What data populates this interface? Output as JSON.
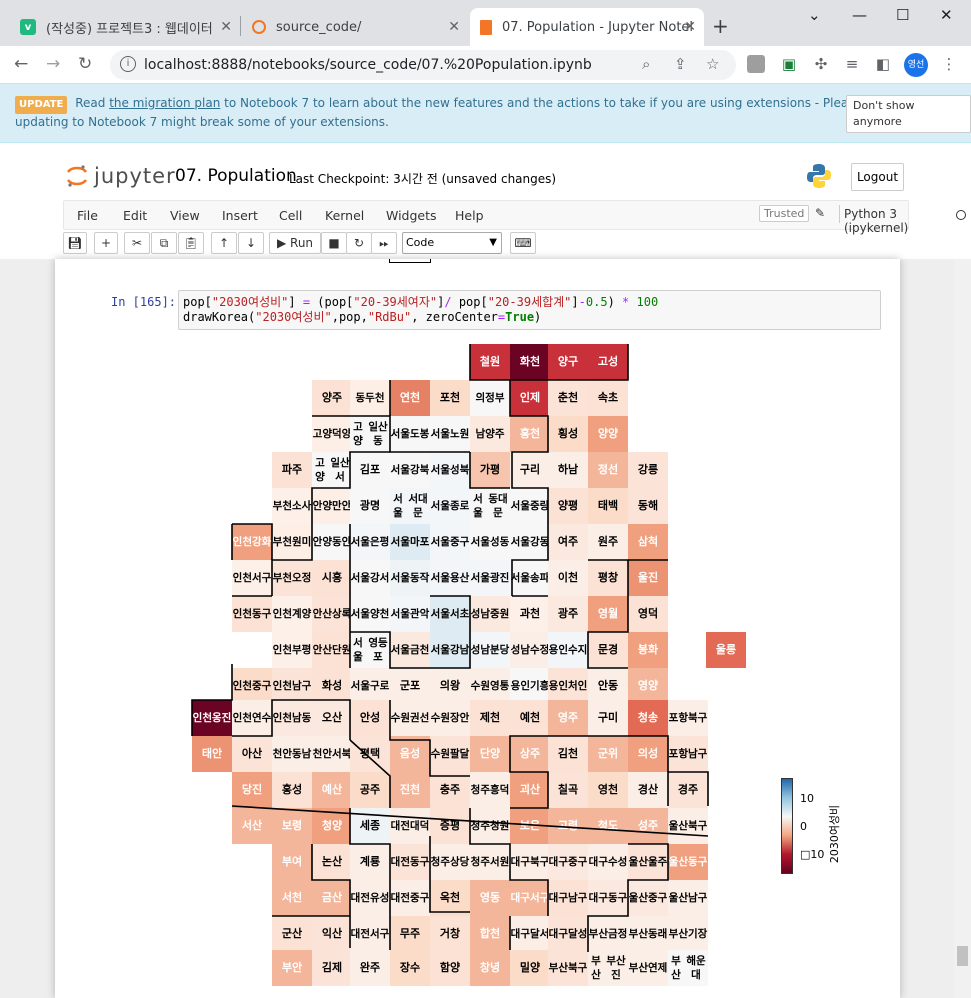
{
  "browser": {
    "tabs": [
      {
        "title": "(작성중) 프로젝트3 : 웹데이터",
        "icon": "v-icon",
        "color": "#20b980"
      },
      {
        "title": "source_code/",
        "icon": "jupyter-tab-icon",
        "color": "#f37626"
      },
      {
        "title": "07. Population - Jupyter Notel",
        "icon": "jupyter-tab-icon",
        "color": "#f37626"
      }
    ],
    "url": "localhost:8888/notebooks/source_code/07.%20Population.ipynb",
    "profile": "영선"
  },
  "banner": {
    "badge": "UPDATE",
    "text_before": "Read",
    "link": "the migration plan",
    "text_after": "to Notebook 7 to learn about the new features and the actions to take if you are using extensions - Please note that updating to Notebook 7 might break some of your extensions.",
    "dismiss": "Don't show anymore"
  },
  "jupyter": {
    "logo": "jupyter",
    "notebook_name": "07. Population",
    "checkpoint": "Last Checkpoint: 3시간 전  (unsaved changes)",
    "logout": "Logout",
    "menu": [
      "File",
      "Edit",
      "View",
      "Insert",
      "Cell",
      "Kernel",
      "Widgets",
      "Help"
    ],
    "trusted": "Trusted",
    "kernel": "Python 3 (ipykernel)",
    "run_label": "Run",
    "cell_type": "Code"
  },
  "cell": {
    "prompt": "In [165]:"
  },
  "chart_data": {
    "type": "heatmap",
    "colormap": "RdBu",
    "colorbar_label": "2030여성비",
    "colorbar_ticks": [
      "10",
      "0",
      "□10"
    ],
    "cells": [
      {
        "label": "철원",
        "color": "#c8303a",
        "text": "#fff"
      },
      {
        "label": "화천",
        "color": "#6b0322",
        "text": "#fff"
      },
      {
        "label": "양구",
        "color": "#c8303a",
        "text": "#fff"
      },
      {
        "label": "고성",
        "color": "#c8303a",
        "text": "#fff"
      },
      {
        "label": "양주",
        "color": "#fbe2d4",
        "text": "#000"
      },
      {
        "label": "동두천",
        "color": "#fdeee6",
        "text": "#000"
      },
      {
        "label": "연천",
        "color": "#e58266",
        "text": "#fff"
      },
      {
        "label": "포천",
        "color": "#fbdcc9",
        "text": "#000"
      },
      {
        "label": "의정부",
        "color": "#f7f7f7",
        "text": "#000"
      },
      {
        "label": "인제",
        "color": "#c8303a",
        "text": "#fff"
      },
      {
        "label": "춘천",
        "color": "#fbe4d7",
        "text": "#000"
      },
      {
        "label": "속초",
        "color": "#fbe2d4",
        "text": "#000"
      },
      {
        "label": "고양\n덕양",
        "color": "#fdeee6",
        "text": "#000"
      },
      {
        "label": "고양\n일산동",
        "color": "#f7f7f7",
        "text": "#000"
      },
      {
        "label": "서울\n도봉",
        "color": "#f7f7f7",
        "text": "#000"
      },
      {
        "label": "서울\n노원",
        "color": "#f7f7f7",
        "text": "#000"
      },
      {
        "label": "남양주",
        "color": "#fbe8de",
        "text": "#000"
      },
      {
        "label": "홍천",
        "color": "#f4b69b",
        "text": "#fff"
      },
      {
        "label": "횡성",
        "color": "#fbdcc9",
        "text": "#000"
      },
      {
        "label": "양양",
        "color": "#f0a07f",
        "text": "#fff"
      },
      {
        "label": "파주",
        "color": "#fbe2d4",
        "text": "#000"
      },
      {
        "label": "고양\n일산서",
        "color": "#f7f7f7",
        "text": "#000"
      },
      {
        "label": "김포",
        "color": "#f7f7f7",
        "text": "#000"
      },
      {
        "label": "서울\n강북",
        "color": "#f7f7f7",
        "text": "#000"
      },
      {
        "label": "서울\n성북",
        "color": "#f3f6f8",
        "text": "#000"
      },
      {
        "label": "가평",
        "color": "#f7c5ad",
        "text": "#000"
      },
      {
        "label": "구리",
        "color": "#fbeee6",
        "text": "#000"
      },
      {
        "label": "하남",
        "color": "#fbeee6",
        "text": "#000"
      },
      {
        "label": "정선",
        "color": "#f4b69b",
        "text": "#fff"
      },
      {
        "label": "강릉",
        "color": "#fbe4d7",
        "text": "#000"
      },
      {
        "label": "부천\n소사",
        "color": "#fdf0e9",
        "text": "#000"
      },
      {
        "label": "안양\n만안",
        "color": "#fdeee6",
        "text": "#000"
      },
      {
        "label": "광명",
        "color": "#f7f7f7",
        "text": "#000"
      },
      {
        "label": "서울\n서대문",
        "color": "#f3f6f8",
        "text": "#000"
      },
      {
        "label": "서울\n종로",
        "color": "#f3f6f8",
        "text": "#000"
      },
      {
        "label": "서울\n동대문",
        "color": "#f7f7f7",
        "text": "#000"
      },
      {
        "label": "서울\n중랑",
        "color": "#f7f7f7",
        "text": "#000"
      },
      {
        "label": "양평",
        "color": "#fbe2d4",
        "text": "#000"
      },
      {
        "label": "태백",
        "color": "#fbdcc9",
        "text": "#000"
      },
      {
        "label": "동해",
        "color": "#fbe4d7",
        "text": "#000"
      },
      {
        "label": "인천\n강화",
        "color": "#f0a07f",
        "text": "#fff"
      },
      {
        "label": "부천\n원미",
        "color": "#fdeee6",
        "text": "#000"
      },
      {
        "label": "안양\n동안",
        "color": "#f7f7f7",
        "text": "#000"
      },
      {
        "label": "서울\n은평",
        "color": "#f3f6f8",
        "text": "#000"
      },
      {
        "label": "서울\n마포",
        "color": "#deebf2",
        "text": "#000"
      },
      {
        "label": "서울\n중구",
        "color": "#f3f6f8",
        "text": "#000"
      },
      {
        "label": "서울\n성동",
        "color": "#f7f7f7",
        "text": "#000"
      },
      {
        "label": "서울\n강동",
        "color": "#f7f7f7",
        "text": "#000"
      },
      {
        "label": "여주",
        "color": "#fbe8de",
        "text": "#000"
      },
      {
        "label": "원주",
        "color": "#fbeee6",
        "text": "#000"
      },
      {
        "label": "삼척",
        "color": "#f0a07f",
        "text": "#fff"
      },
      {
        "label": "인천\n서구",
        "color": "#fdf0e9",
        "text": "#000"
      },
      {
        "label": "부천\n오정",
        "color": "#fbe4d7",
        "text": "#000"
      },
      {
        "label": "시흥",
        "color": "#fbe2d4",
        "text": "#000"
      },
      {
        "label": "서울\n강서",
        "color": "#f7f7f7",
        "text": "#000"
      },
      {
        "label": "서울\n동작",
        "color": "#eef3f6",
        "text": "#000"
      },
      {
        "label": "서울\n용산",
        "color": "#f3f6f8",
        "text": "#000"
      },
      {
        "label": "서울\n광진",
        "color": "#f3f6f8",
        "text": "#000"
      },
      {
        "label": "서울\n송파",
        "color": "#f7f7f7",
        "text": "#000"
      },
      {
        "label": "이천",
        "color": "#fbeee6",
        "text": "#000"
      },
      {
        "label": "평창",
        "color": "#fbe2d4",
        "text": "#000"
      },
      {
        "label": "울진",
        "color": "#ec9373",
        "text": "#fff"
      },
      {
        "label": "인천\n동구",
        "color": "#fbe2d4",
        "text": "#000"
      },
      {
        "label": "인천\n계양",
        "color": "#fdf0e9",
        "text": "#000"
      },
      {
        "label": "안산\n상록",
        "color": "#fbe4d7",
        "text": "#000"
      },
      {
        "label": "서울\n양천",
        "color": "#f7f7f7",
        "text": "#000"
      },
      {
        "label": "서울\n관악",
        "color": "#f3f6f8",
        "text": "#000"
      },
      {
        "label": "서울\n서초",
        "color": "#deebf2",
        "text": "#000"
      },
      {
        "label": "성남\n중원",
        "color": "#fbe8de",
        "text": "#000"
      },
      {
        "label": "과천",
        "color": "#fdf0e9",
        "text": "#000"
      },
      {
        "label": "광주",
        "color": "#fbe8de",
        "text": "#000"
      },
      {
        "label": "영월",
        "color": "#f0a07f",
        "text": "#fff"
      },
      {
        "label": "영덕",
        "color": "#fbe2d4",
        "text": "#000"
      },
      {
        "label": "인천\n부평",
        "color": "#fdf0e9",
        "text": "#000"
      },
      {
        "label": "안산\n단원",
        "color": "#fbe2d4",
        "text": "#000"
      },
      {
        "label": "서울\n영등포",
        "color": "#f7f7f7",
        "text": "#000"
      },
      {
        "label": "서울\n금천",
        "color": "#fbe8de",
        "text": "#000"
      },
      {
        "label": "서울\n강남",
        "color": "#deebf2",
        "text": "#000"
      },
      {
        "label": "성남\n분당",
        "color": "#f3f6f8",
        "text": "#000"
      },
      {
        "label": "성남\n수정",
        "color": "#fbeee6",
        "text": "#000"
      },
      {
        "label": "용인\n수지",
        "color": "#f3f6f8",
        "text": "#000"
      },
      {
        "label": "문경",
        "color": "#fbe2d4",
        "text": "#000"
      },
      {
        "label": "봉화",
        "color": "#f0a07f",
        "text": "#fff"
      },
      {
        "label": "울릉",
        "color": "#e36b55",
        "text": "#fff"
      },
      {
        "label": "인천\n중구",
        "color": "#fbdcc9",
        "text": "#000"
      },
      {
        "label": "인천\n남구",
        "color": "#fbe4d7",
        "text": "#000"
      },
      {
        "label": "화성",
        "color": "#fbe2d4",
        "text": "#000"
      },
      {
        "label": "서울\n구로",
        "color": "#fbeee6",
        "text": "#000"
      },
      {
        "label": "군포",
        "color": "#fbeee6",
        "text": "#000"
      },
      {
        "label": "의왕",
        "color": "#fbeee6",
        "text": "#000"
      },
      {
        "label": "수원\n영통",
        "color": "#fbeee6",
        "text": "#000"
      },
      {
        "label": "용인\n기흥",
        "color": "#f7f7f7",
        "text": "#000"
      },
      {
        "label": "용인\n처인",
        "color": "#fbe4d7",
        "text": "#000"
      },
      {
        "label": "안동",
        "color": "#fbeee6",
        "text": "#000"
      },
      {
        "label": "영양",
        "color": "#f4b69b",
        "text": "#fff"
      },
      {
        "label": "인천\n옹진",
        "color": "#6b0322",
        "text": "#fff"
      },
      {
        "label": "인천\n연수",
        "color": "#fbeee6",
        "text": "#000"
      },
      {
        "label": "인천\n남동",
        "color": "#fbe8de",
        "text": "#000"
      },
      {
        "label": "오산",
        "color": "#fbe8de",
        "text": "#000"
      },
      {
        "label": "안성",
        "color": "#fbe2d4",
        "text": "#000"
      },
      {
        "label": "수원\n권선",
        "color": "#fbeee6",
        "text": "#000"
      },
      {
        "label": "수원\n장안",
        "color": "#fbeee6",
        "text": "#000"
      },
      {
        "label": "제천",
        "color": "#fbe2d4",
        "text": "#000"
      },
      {
        "label": "예천",
        "color": "#fbe2d4",
        "text": "#000"
      },
      {
        "label": "영주",
        "color": "#f4b69b",
        "text": "#fff"
      },
      {
        "label": "구미",
        "color": "#fbeee6",
        "text": "#000"
      },
      {
        "label": "청송",
        "color": "#e36b55",
        "text": "#fff"
      },
      {
        "label": "포항\n북구",
        "color": "#fbeee6",
        "text": "#000"
      },
      {
        "label": "태안",
        "color": "#ec9373",
        "text": "#fff"
      },
      {
        "label": "아산",
        "color": "#fbe4d7",
        "text": "#000"
      },
      {
        "label": "천안\n동남",
        "color": "#fbeee6",
        "text": "#000"
      },
      {
        "label": "천안\n서북",
        "color": "#fbeee6",
        "text": "#000"
      },
      {
        "label": "평택",
        "color": "#fbe4d7",
        "text": "#000"
      },
      {
        "label": "음성",
        "color": "#f4b69b",
        "text": "#fff"
      },
      {
        "label": "수원\n팔달",
        "color": "#fbe4d7",
        "text": "#000"
      },
      {
        "label": "단양",
        "color": "#f4b69b",
        "text": "#fff"
      },
      {
        "label": "상주",
        "color": "#f4b69b",
        "text": "#fff"
      },
      {
        "label": "김천",
        "color": "#fbe2d4",
        "text": "#000"
      },
      {
        "label": "군위",
        "color": "#f4b69b",
        "text": "#fff"
      },
      {
        "label": "의성",
        "color": "#f0a07f",
        "text": "#fff"
      },
      {
        "label": "포항\n남구",
        "color": "#fbe4d7",
        "text": "#000"
      },
      {
        "label": "당진",
        "color": "#f0a07f",
        "text": "#fff"
      },
      {
        "label": "홍성",
        "color": "#fbe2d4",
        "text": "#000"
      },
      {
        "label": "예산",
        "color": "#f4b69b",
        "text": "#fff"
      },
      {
        "label": "공주",
        "color": "#fbdcc9",
        "text": "#000"
      },
      {
        "label": "진천",
        "color": "#f4b69b",
        "text": "#fff"
      },
      {
        "label": "충주",
        "color": "#fbe2d4",
        "text": "#000"
      },
      {
        "label": "청주\n흥덕",
        "color": "#fbeee6",
        "text": "#000"
      },
      {
        "label": "괴산",
        "color": "#f0a07f",
        "text": "#fff"
      },
      {
        "label": "칠곡",
        "color": "#fbe4d7",
        "text": "#000"
      },
      {
        "label": "영천",
        "color": "#fbdcc9",
        "text": "#000"
      },
      {
        "label": "경산",
        "color": "#fbeee6",
        "text": "#000"
      },
      {
        "label": "경주",
        "color": "#fbe4d7",
        "text": "#000"
      },
      {
        "label": "서산",
        "color": "#f4b69b",
        "text": "#fff"
      },
      {
        "label": "보령",
        "color": "#f4b69b",
        "text": "#fff"
      },
      {
        "label": "청양",
        "color": "#f0a07f",
        "text": "#fff"
      },
      {
        "label": "세종",
        "color": "#eef3f6",
        "text": "#000"
      },
      {
        "label": "대전\n대덕",
        "color": "#fbeee6",
        "text": "#000"
      },
      {
        "label": "증평",
        "color": "#fbe2d4",
        "text": "#000"
      },
      {
        "label": "청주\n청원",
        "color": "#fbeee6",
        "text": "#000"
      },
      {
        "label": "보은",
        "color": "#f0a07f",
        "text": "#fff"
      },
      {
        "label": "고령",
        "color": "#f4b69b",
        "text": "#fff"
      },
      {
        "label": "청도",
        "color": "#f4b69b",
        "text": "#fff"
      },
      {
        "label": "성주",
        "color": "#f4b69b",
        "text": "#fff"
      },
      {
        "label": "울산\n북구",
        "color": "#fbeee6",
        "text": "#000"
      },
      {
        "label": "부여",
        "color": "#f4b69b",
        "text": "#fff"
      },
      {
        "label": "논산",
        "color": "#fbe2d4",
        "text": "#000"
      },
      {
        "label": "계룡",
        "color": "#fbeee6",
        "text": "#000"
      },
      {
        "label": "대전\n동구",
        "color": "#fbe4d7",
        "text": "#000"
      },
      {
        "label": "청주\n상당",
        "color": "#fbeee6",
        "text": "#000"
      },
      {
        "label": "청주\n서원",
        "color": "#fbeee6",
        "text": "#000"
      },
      {
        "label": "대구\n북구",
        "color": "#fbeee6",
        "text": "#000"
      },
      {
        "label": "대구\n중구",
        "color": "#fbe8de",
        "text": "#000"
      },
      {
        "label": "대구\n수성",
        "color": "#fbeee6",
        "text": "#000"
      },
      {
        "label": "울산\n울주",
        "color": "#fbe4d7",
        "text": "#000"
      },
      {
        "label": "울산\n동구",
        "color": "#f0a07f",
        "text": "#fff"
      },
      {
        "label": "서천",
        "color": "#f4b69b",
        "text": "#fff"
      },
      {
        "label": "금산",
        "color": "#f4b69b",
        "text": "#fff"
      },
      {
        "label": "대전\n유성",
        "color": "#fbeee6",
        "text": "#000"
      },
      {
        "label": "대전\n중구",
        "color": "#fbeee6",
        "text": "#000"
      },
      {
        "label": "옥천",
        "color": "#fbdcc9",
        "text": "#000"
      },
      {
        "label": "영동",
        "color": "#f4b69b",
        "text": "#fff"
      },
      {
        "label": "대구\n서구",
        "color": "#f4b69b",
        "text": "#fff"
      },
      {
        "label": "대구\n남구",
        "color": "#fbe2d4",
        "text": "#000"
      },
      {
        "label": "대구\n동구",
        "color": "#fbe8de",
        "text": "#000"
      },
      {
        "label": "울산\n중구",
        "color": "#fbe8de",
        "text": "#000"
      },
      {
        "label": "울산\n남구",
        "color": "#fbeee6",
        "text": "#000"
      },
      {
        "label": "군산",
        "color": "#fbe2d4",
        "text": "#000"
      },
      {
        "label": "익산",
        "color": "#fbe4d7",
        "text": "#000"
      },
      {
        "label": "대전\n서구",
        "color": "#fbeee6",
        "text": "#000"
      },
      {
        "label": "무주",
        "color": "#fbdcc9",
        "text": "#000"
      },
      {
        "label": "거창",
        "color": "#fbe2d4",
        "text": "#000"
      },
      {
        "label": "합천",
        "color": "#f4b69b",
        "text": "#fff"
      },
      {
        "label": "대구\n달서",
        "color": "#fbeee6",
        "text": "#000"
      },
      {
        "label": "대구\n달성",
        "color": "#fbe4d7",
        "text": "#000"
      },
      {
        "label": "부산\n금정",
        "color": "#fbeee6",
        "text": "#000"
      },
      {
        "label": "부산\n동래",
        "color": "#fbeee6",
        "text": "#000"
      },
      {
        "label": "부산\n기장",
        "color": "#fbeee6",
        "text": "#000"
      },
      {
        "label": "부안",
        "color": "#f4b69b",
        "text": "#fff"
      },
      {
        "label": "김제",
        "color": "#fbe4d7",
        "text": "#000"
      },
      {
        "label": "완주",
        "color": "#fbeee6",
        "text": "#000"
      },
      {
        "label": "장수",
        "color": "#fbdcc9",
        "text": "#000"
      },
      {
        "label": "함양",
        "color": "#fbe2d4",
        "text": "#000"
      },
      {
        "label": "창녕",
        "color": "#f4b69b",
        "text": "#fff"
      },
      {
        "label": "밀양",
        "color": "#fbdcc9",
        "text": "#000"
      },
      {
        "label": "부산\n북구",
        "color": "#fbe4d7",
        "text": "#000"
      },
      {
        "label": "부산\n부산진",
        "color": "#fbeee6",
        "text": "#000"
      },
      {
        "label": "부산\n연제",
        "color": "#fbeee6",
        "text": "#000"
      },
      {
        "label": "부산\n해운대",
        "color": "#f7f7f7",
        "text": "#000"
      }
    ]
  }
}
